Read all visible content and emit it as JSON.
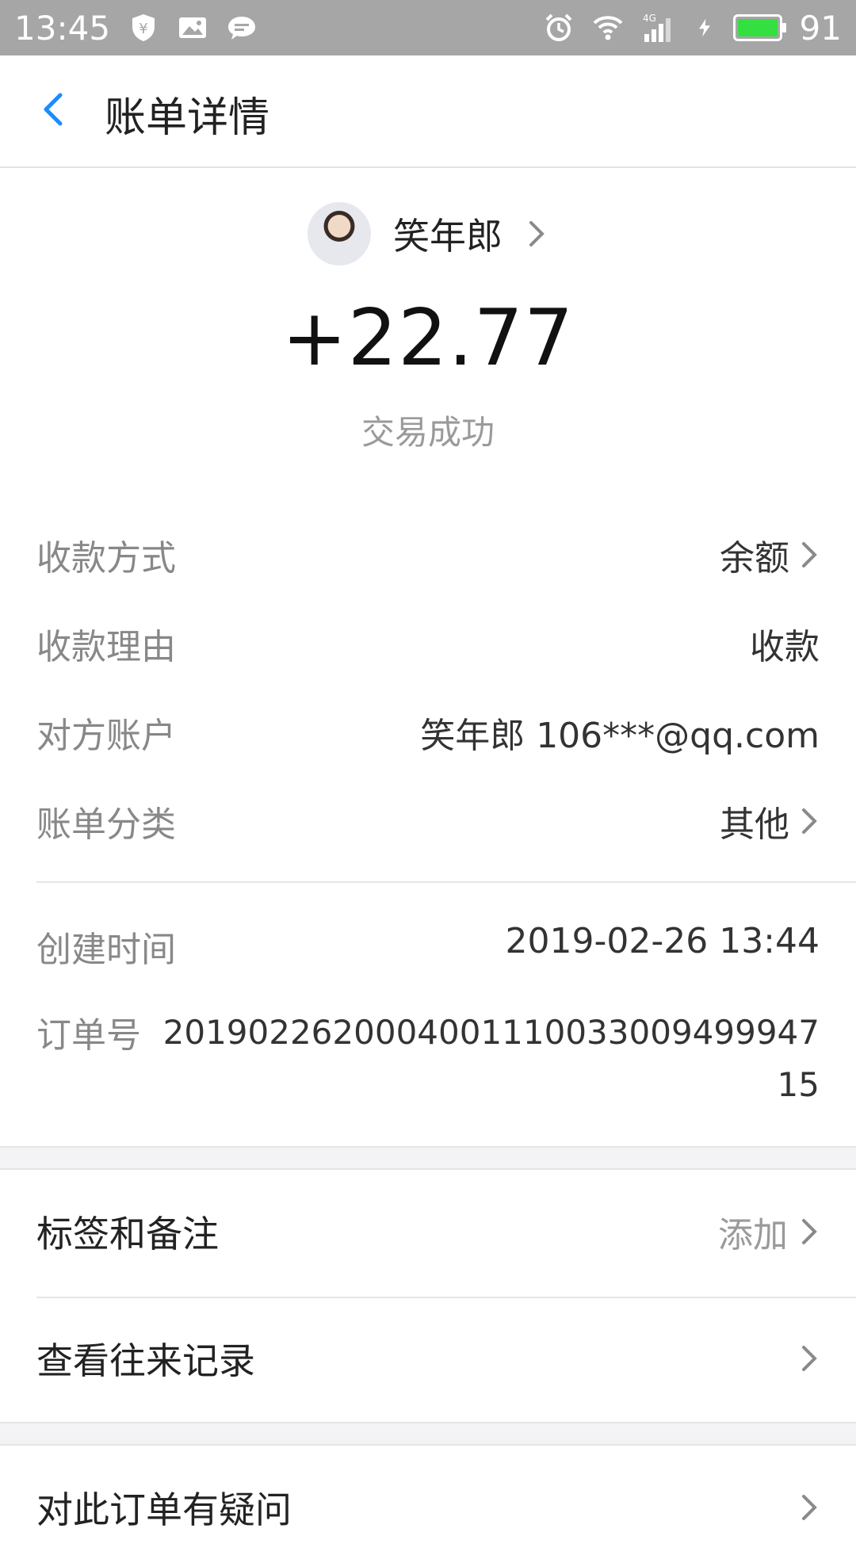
{
  "status_bar": {
    "time": "13:45",
    "battery": "91",
    "network": "4G"
  },
  "header": {
    "title": "账单详情"
  },
  "payer": {
    "name": "笑年郎"
  },
  "amount": "+22.77",
  "status": "交易成功",
  "details": [
    {
      "label": "收款方式",
      "value": "余额"
    },
    {
      "label": "收款理由",
      "value": "收款"
    },
    {
      "label": "对方账户",
      "value": "笑年郎 106***@qq.com"
    },
    {
      "label": "账单分类",
      "value": "其他"
    }
  ],
  "meta": {
    "created_label": "创建时间",
    "created_value": "2019-02-26 13:44",
    "order_label": "订单号",
    "order_line1": "2019022620004001110033009499947",
    "order_line2": "15"
  },
  "actions": {
    "tags": {
      "label": "标签和备注",
      "hint": "添加"
    },
    "history": {
      "label": "查看往来记录"
    },
    "question": {
      "label": "对此订单有疑问"
    }
  },
  "colors": {
    "accent": "#1a8cff",
    "status_bar": "#a6a6a6",
    "battery": "#33e040"
  }
}
